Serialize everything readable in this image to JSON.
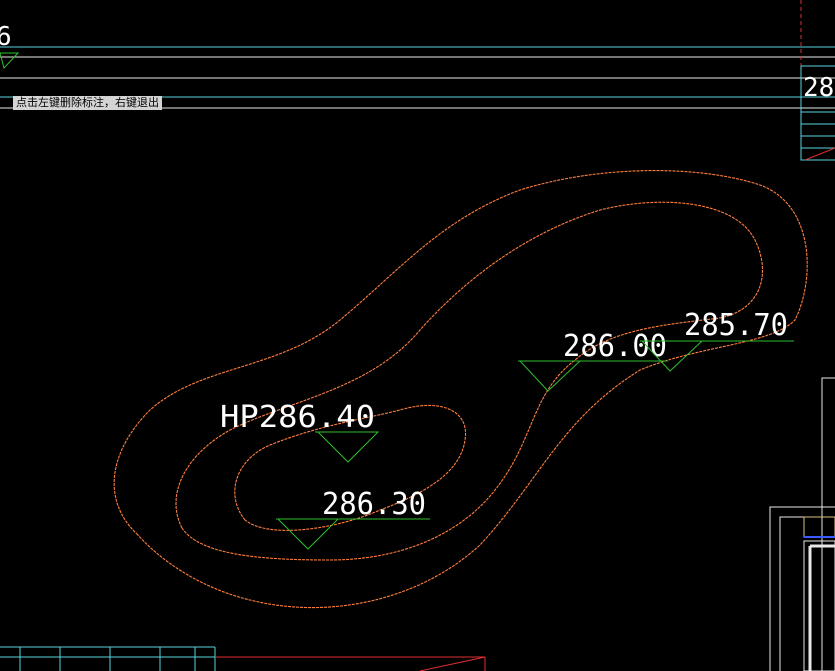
{
  "status": {
    "prompt": "点击左键删除标注，右键退出"
  },
  "drawing": {
    "labels": {
      "hp": "HP286.40",
      "l28630": "286.30",
      "l28600": "286.00",
      "l28570": "285.70",
      "edge_top_left": "6",
      "edge_top_right": "28"
    },
    "colors": {
      "background": "#000000",
      "contour": "#ff7f3f",
      "marker": "#2fbf2f",
      "guide_cyan": "#56d6e0",
      "guide_white": "#e8e8e8",
      "accent_red": "#e03030"
    }
  }
}
